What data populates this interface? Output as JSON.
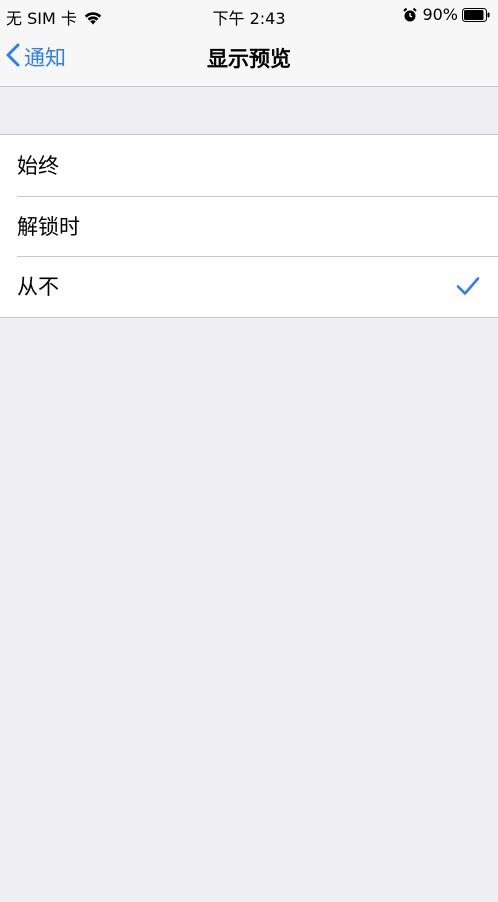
{
  "status_bar": {
    "carrier": "无 SIM 卡",
    "time": "下午 2:43",
    "battery": "90%"
  },
  "nav": {
    "back_label": "通知",
    "title": "显示预览"
  },
  "options": [
    {
      "label": "始终",
      "selected": false
    },
    {
      "label": "解锁时",
      "selected": false
    },
    {
      "label": "从不",
      "selected": true
    }
  ],
  "colors": {
    "accent": "#2f7cf6",
    "background": "#efeff4",
    "separator": "#c8c7cc"
  },
  "icons": [
    "wifi-icon",
    "alarm-icon",
    "battery-icon",
    "chevron-left-icon",
    "checkmark-icon"
  ]
}
